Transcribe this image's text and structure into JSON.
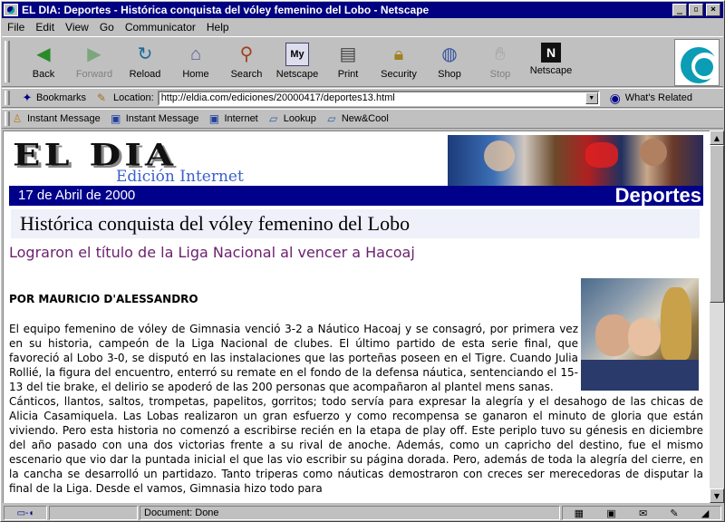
{
  "window": {
    "title": "EL DIA: Deportes - Histórica conquista del vóley femenino del Lobo - Netscape"
  },
  "menu": [
    "File",
    "Edit",
    "View",
    "Go",
    "Communicator",
    "Help"
  ],
  "toolbar": {
    "buttons": [
      {
        "label": "Back",
        "icon": "back-arrow-icon",
        "enabled": true
      },
      {
        "label": "Forward",
        "icon": "forward-arrow-icon",
        "enabled": false
      },
      {
        "label": "Reload",
        "icon": "reload-icon",
        "enabled": true
      },
      {
        "label": "Home",
        "icon": "home-icon",
        "enabled": true
      },
      {
        "label": "Search",
        "icon": "search-icon",
        "enabled": true
      },
      {
        "label": "Netscape",
        "icon": "my-netscape-icon",
        "enabled": true
      },
      {
        "label": "Print",
        "icon": "print-icon",
        "enabled": true
      },
      {
        "label": "Security",
        "icon": "security-lock-icon",
        "enabled": true
      },
      {
        "label": "Shop",
        "icon": "shop-bag-icon",
        "enabled": true
      },
      {
        "label": "Stop",
        "icon": "stop-icon",
        "enabled": false
      },
      {
        "label": "Netscape",
        "icon": "netscape-n-icon",
        "enabled": true
      }
    ]
  },
  "location": {
    "bookmarks_label": "Bookmarks",
    "location_label": "Location:",
    "url": "http://eldia.com/ediciones/20000417/deportes13.html",
    "related_label": "What's Related"
  },
  "personal_toolbar": [
    "Instant Message",
    "Instant Message",
    "Internet",
    "Lookup",
    "New&Cool"
  ],
  "page": {
    "brand": "EL DIA",
    "edition": "Edición Internet",
    "date": "17 de Abril de 2000",
    "section": "Deportes",
    "headline": "Histórica conquista del vóley femenino del Lobo",
    "subheadline": "Lograron el título de la Liga Nacional al vencer a Hacoaj",
    "byline": "POR MAURICIO D'ALESSANDRO",
    "paragraphs": [
      "El equipo femenino de vóley de Gimnasia venció 3-2 a Náutico Hacoaj y se consagró, por primera vez en su historia, campeón de la Liga Nacional de clubes. El último partido de esta serie final, que favoreció al Lobo 3-0, se disputó en las instalaciones que las porteñas poseen en el Tigre. Cuando Julia Rollié, la figura del encuentro, enterró su remate en el fondo de la defensa náutica, sentenciando el 15-13 del tie brake, el delirio se apoderó de las 200 personas que acompañaron al plantel mens sanas.",
      "Cánticos, llantos, saltos, trompetas, papelitos, gorritos; todo servía para expresar la alegría y el desahogo de las chicas de Alicia Casamiquela. Las Lobas realizaron un gran esfuerzo y como recompensa se ganaron el minuto de gloria que están viviendo. Pero esta historia no comenzó a escribirse recién en la etapa de play off. Este periplo tuvo su génesis en diciembre del año pasado con una dos victorias frente a su rival de anoche. Además, como un capricho del destino, fue el mismo escenario que vio dar la puntada inicial el que las vio escribir su página dorada. Pero, además de toda la alegría del cierre, en la cancha se desarrolló un partidazo. Tanto triperas como náuticas demostraron con creces ser merecedoras de disputar la final de la Liga. Desde el vamos, Gimnasia hizo todo para"
    ]
  },
  "status": {
    "text": "Document: Done"
  }
}
